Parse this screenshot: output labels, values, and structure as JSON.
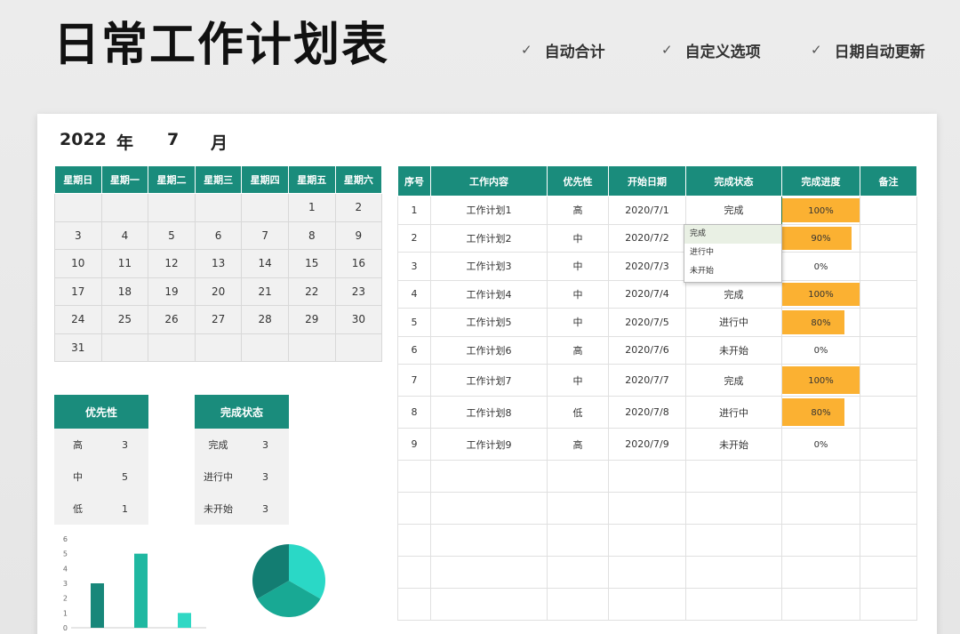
{
  "header": {
    "title": "日常工作计划表",
    "features": [
      "自动合计",
      "自定义选项",
      "日期自动更新"
    ],
    "check": "✓"
  },
  "year_month": {
    "year": "2022",
    "year_label": "年",
    "month": "7",
    "month_label": "月"
  },
  "calendar": {
    "weekdays": [
      "星期日",
      "星期一",
      "星期二",
      "星期三",
      "星期四",
      "星期五",
      "星期六"
    ],
    "weeks": [
      [
        "",
        "",
        "",
        "",
        "",
        "1",
        "2"
      ],
      [
        "3",
        "4",
        "5",
        "6",
        "7",
        "8",
        "9"
      ],
      [
        "10",
        "11",
        "12",
        "13",
        "14",
        "15",
        "16"
      ],
      [
        "17",
        "18",
        "19",
        "20",
        "21",
        "22",
        "23"
      ],
      [
        "24",
        "25",
        "26",
        "27",
        "28",
        "29",
        "30"
      ],
      [
        "31",
        "",
        "",
        "",
        "",
        "",
        ""
      ]
    ]
  },
  "tasks": {
    "headers": [
      "序号",
      "工作内容",
      "优先性",
      "开始日期",
      "完成状态",
      "完成进度",
      "备注"
    ],
    "rows": [
      {
        "no": "1",
        "name": "工作计划1",
        "priority": "高",
        "date": "2020/7/1",
        "status": "完成",
        "progress": 1.0,
        "progress_label": "100%",
        "note": ""
      },
      {
        "no": "2",
        "name": "工作计划2",
        "priority": "中",
        "date": "2020/7/2",
        "status": "",
        "progress": 0.9,
        "progress_label": "90%",
        "note": ""
      },
      {
        "no": "3",
        "name": "工作计划3",
        "priority": "中",
        "date": "2020/7/3",
        "status": "",
        "progress": 0,
        "progress_label": "0%",
        "note": ""
      },
      {
        "no": "4",
        "name": "工作计划4",
        "priority": "中",
        "date": "2020/7/4",
        "status": "完成",
        "progress": 1.0,
        "progress_label": "100%",
        "note": ""
      },
      {
        "no": "5",
        "name": "工作计划5",
        "priority": "中",
        "date": "2020/7/5",
        "status": "进行中",
        "progress": 0.8,
        "progress_label": "80%",
        "note": ""
      },
      {
        "no": "6",
        "name": "工作计划6",
        "priority": "高",
        "date": "2020/7/6",
        "status": "未开始",
        "progress": 0,
        "progress_label": "0%",
        "note": ""
      },
      {
        "no": "7",
        "name": "工作计划7",
        "priority": "中",
        "date": "2020/7/7",
        "status": "完成",
        "progress": 1.0,
        "progress_label": "100%",
        "note": ""
      },
      {
        "no": "8",
        "name": "工作计划8",
        "priority": "低",
        "date": "2020/7/8",
        "status": "进行中",
        "progress": 0.8,
        "progress_label": "80%",
        "note": ""
      },
      {
        "no": "9",
        "name": "工作计划9",
        "priority": "高",
        "date": "2020/7/9",
        "status": "未开始",
        "progress": 0,
        "progress_label": "0%",
        "note": ""
      }
    ],
    "empty_rows": 5,
    "progress_color": "#fbb132"
  },
  "status_dropdown": {
    "options": [
      "完成",
      "进行中",
      "未开始"
    ],
    "selected": "完成",
    "arrow": "▾"
  },
  "priority_summary": {
    "header": "优先性",
    "rows": [
      [
        "高",
        "3"
      ],
      [
        "中",
        "5"
      ],
      [
        "低",
        "1"
      ]
    ]
  },
  "status_summary": {
    "header": "完成状态",
    "rows": [
      [
        "完成",
        "3"
      ],
      [
        "进行中",
        "3"
      ],
      [
        "未开始",
        "3"
      ]
    ]
  },
  "chart_data": [
    {
      "type": "bar",
      "categories": [
        "高",
        "中",
        "低"
      ],
      "values": [
        3,
        5,
        1
      ],
      "ylim": [
        0,
        6
      ],
      "yticks": [
        0,
        1,
        2,
        3,
        4,
        5,
        6
      ],
      "show_category_labels": false,
      "colors": [
        "#18877a",
        "#1fb8a1",
        "#30d8c4"
      ]
    },
    {
      "type": "pie",
      "categories": [
        "完成",
        "进行中",
        "未开始"
      ],
      "values": [
        3,
        3,
        3
      ],
      "colors": [
        "#2ad8c6",
        "#18a994",
        "#137d72"
      ]
    }
  ],
  "colors": {
    "accent": "#1a8c7c"
  }
}
